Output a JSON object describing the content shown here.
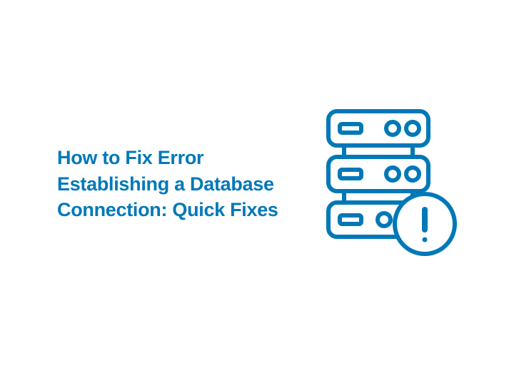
{
  "heading": "How to Fix Error Establishing a Database Connection: Quick Fixes",
  "colors": {
    "primary": "#0078b8"
  }
}
